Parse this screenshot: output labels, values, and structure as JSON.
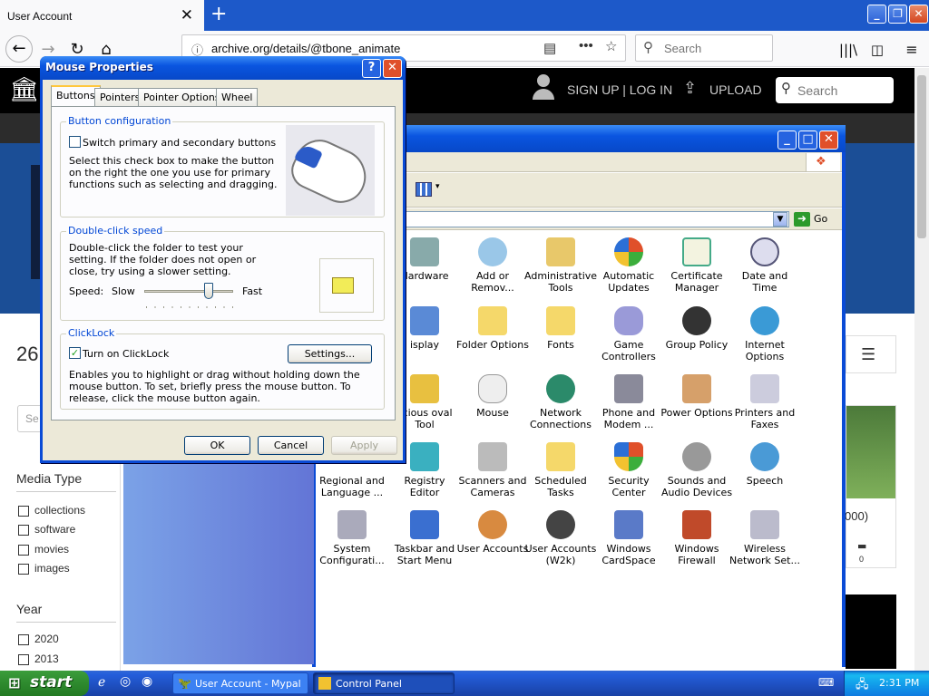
{
  "browser": {
    "tab_title": "User Account",
    "url": "archive.org/details/@tbone_animate",
    "search_placeholder": "Search"
  },
  "site": {
    "signup_login": "SIGN UP | LOG IN",
    "upload": "UPLOAD",
    "search_placeholder": "Search",
    "count_partial": "26",
    "search_partial": "Se",
    "media_type_heading": "Media Type",
    "media_types": [
      "collections",
      "software",
      "movies",
      "images"
    ],
    "year_heading": "Year",
    "years": [
      "2020",
      "2013"
    ],
    "card_partial": "000)",
    "comment_count": "0"
  },
  "control_panel": {
    "go_label": "Go",
    "icons": [
      [
        "Hardware",
        "Add or Remov...",
        "Administrative Tools",
        "Automatic Updates",
        "Certificate Manager",
        "Date and Time"
      ],
      [
        "isplay",
        "Folder Options",
        "Fonts",
        "Game Controllers",
        "Group Policy",
        "Internet Options"
      ],
      [
        "licious oval Tool",
        "Mouse",
        "Network Connections",
        "Phone and Modem ...",
        "Power Options",
        "Printers and Faxes"
      ],
      [
        "Regional and Language ...",
        "Registry Editor",
        "Scanners and Cameras",
        "Scheduled Tasks",
        "Security Center",
        "Sounds and Audio Devices",
        "Speech"
      ],
      [
        "System Configurati...",
        "Taskbar and Start Menu",
        "User Accounts",
        "User Accounts (W2k)",
        "Windows CardSpace",
        "Windows Firewall",
        "Wireless Network Set..."
      ]
    ]
  },
  "dialog": {
    "title": "Mouse Properties",
    "tabs": [
      "Buttons",
      "Pointers",
      "Pointer Options",
      "Wheel"
    ],
    "button_config_label": "Button configuration",
    "switch_buttons_label": "Switch primary and secondary buttons",
    "switch_buttons_desc": "Select this check box to make the button on the right the one you use for primary functions such as selecting and dragging.",
    "dblclick_label": "Double-click speed",
    "dblclick_desc": "Double-click the folder to test your setting. If the folder does not open or close, try using a slower setting.",
    "speed_label": "Speed:",
    "slow_label": "Slow",
    "fast_label": "Fast",
    "speed_value": 0.72,
    "clicklock_label": "ClickLock",
    "clicklock_check_label": "Turn on ClickLock",
    "clicklock_checked": true,
    "settings_button": "Settings...",
    "clicklock_desc": "Enables you to highlight or drag without holding down the mouse button. To set, briefly press the mouse button. To release, click the mouse button again.",
    "ok": "OK",
    "cancel": "Cancel",
    "apply": "Apply"
  },
  "taskbar": {
    "start": "start",
    "tasks": [
      "User Account - Mypal",
      "Control Panel"
    ],
    "clock": "2:31 PM"
  }
}
